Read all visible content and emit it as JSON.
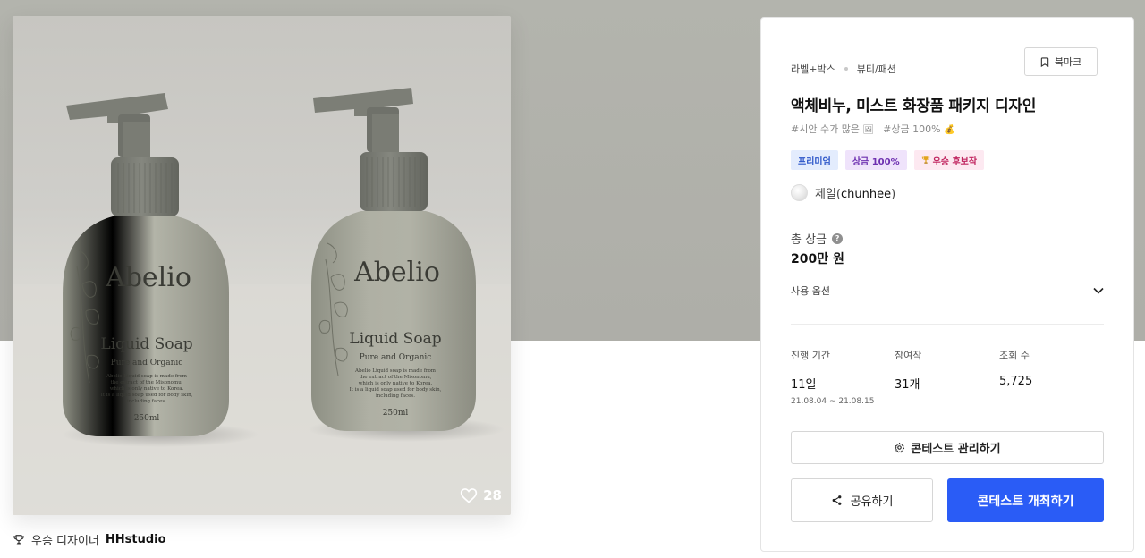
{
  "product_image": {
    "alt": "Abelio Liquid Soap bottles",
    "bottle_brand": "Abelio",
    "bottle_product": "Liquid Soap",
    "bottle_tagline": "Pure and Organic",
    "bottle_desc_lines": [
      "Abelio Liquid soap is made from",
      "the extract of the Misonomu,",
      "which is only native to Korea.",
      "It is a liquid soap used for body skin,",
      "including faces."
    ],
    "bottle_volume": "250ml",
    "likes": "28"
  },
  "designer": {
    "prefix": "우승 디자이너",
    "name": "HHstudio"
  },
  "panel": {
    "breadcrumb": [
      "라벨+박스",
      "뷰티/패션"
    ],
    "bookmark_label": "북마크",
    "title": "액체비누, 미스트 화장품 패키지 디자인",
    "hashtags": [
      {
        "text": "#시안 수가 많은",
        "emoji": "🖼"
      },
      {
        "text": "#상금 100%",
        "emoji": "💰"
      }
    ],
    "badges": {
      "premium": "프리미엄",
      "prize": "상금 100%",
      "winner": "우승 후보작"
    },
    "owner": {
      "name": "제일",
      "uid": "chunhee"
    },
    "prize_label": "총 상금",
    "prize_value": "200만 원",
    "usage_label": "사용 옵션",
    "stats": {
      "period_label": "진행 기간",
      "period_value": "11일",
      "period_range": "21.08.04 ~ 21.08.15",
      "entries_label": "참여작",
      "entries_value": "31개",
      "views_label": "조회 수",
      "views_value": "5,725"
    },
    "manage_label": "콘테스트 관리하기",
    "share_label": "공유하기",
    "host_label": "콘테스트 개최하기"
  },
  "colors": {
    "primary": "#2a5cf6",
    "bottle": "#a7a89b",
    "pump": "#7b7d75"
  }
}
